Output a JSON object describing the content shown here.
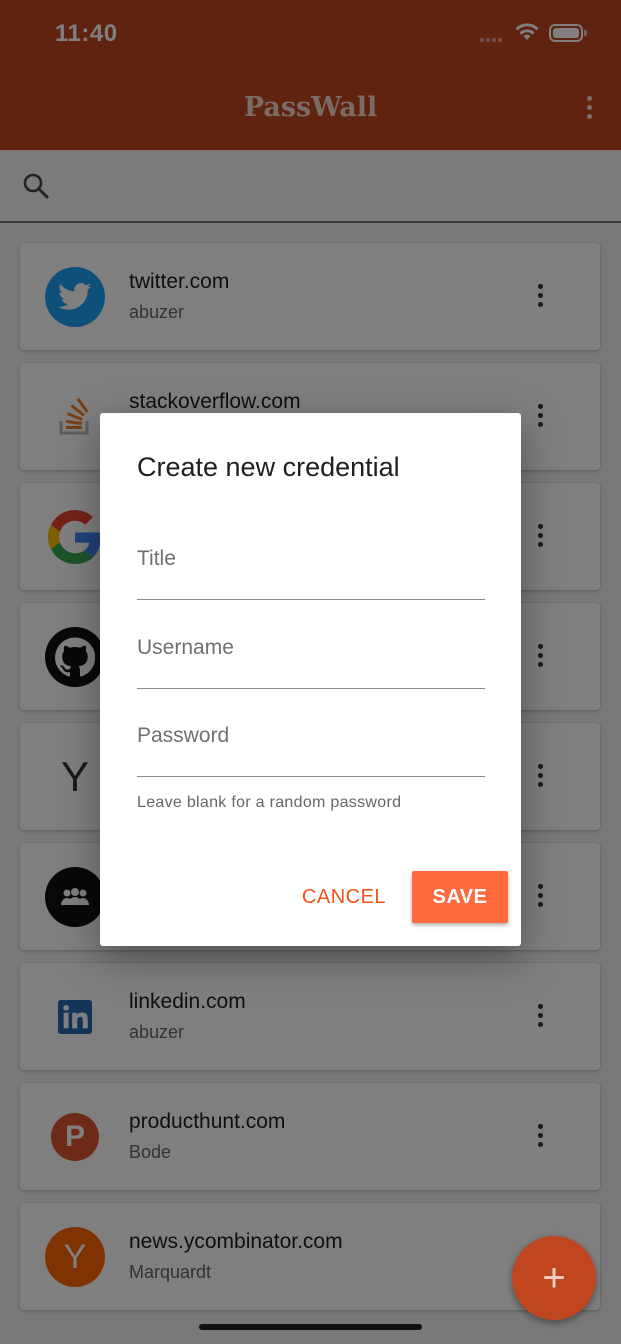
{
  "status_bar": {
    "time": "11:40"
  },
  "app_bar": {
    "title": "PassWall",
    "menu_icon": "kebab-menu-icon"
  },
  "search": {
    "icon": "search-icon",
    "placeholder": ""
  },
  "credentials": [
    {
      "title": "twitter.com",
      "username": "abuzer",
      "icon": "twitter-logo",
      "color": "#1da1f2"
    },
    {
      "title": "stackoverflow.com",
      "username": "",
      "icon": "stackoverflow-logo",
      "color": "#f48024"
    },
    {
      "title": "",
      "username": "",
      "icon": "google-logo",
      "color": "#4285f4"
    },
    {
      "title": "",
      "username": "",
      "icon": "github-logo",
      "color": "#000000"
    },
    {
      "title": "",
      "username": "",
      "icon": "letter-avatar",
      "letter": "Y",
      "color": "#ffffff"
    },
    {
      "title": "",
      "username": "",
      "icon": "meetup-logo",
      "color": "#000000"
    },
    {
      "title": "linkedin.com",
      "username": "abuzer",
      "icon": "linkedin-logo",
      "color": "#2867b2"
    },
    {
      "title": "producthunt.com",
      "username": "Bode",
      "icon": "producthunt-logo",
      "letter": "P",
      "color": "#da552f"
    },
    {
      "title": "news.ycombinator.com",
      "username": "Marquardt",
      "icon": "letter-avatar",
      "letter": "Y",
      "color": "#ff6600"
    }
  ],
  "dialog": {
    "title": "Create new credential",
    "fields": {
      "title_placeholder": "Title",
      "username_placeholder": "Username",
      "password_placeholder": "Password"
    },
    "helper": "Leave blank for a random password",
    "cancel_label": "CANCEL",
    "save_label": "SAVE"
  },
  "fab": {
    "icon": "plus-icon",
    "label": "+"
  },
  "colors": {
    "primary": "#c0461f",
    "accent": "#ff6b3e",
    "scrim": "rgba(0,0,0,0.5)"
  }
}
